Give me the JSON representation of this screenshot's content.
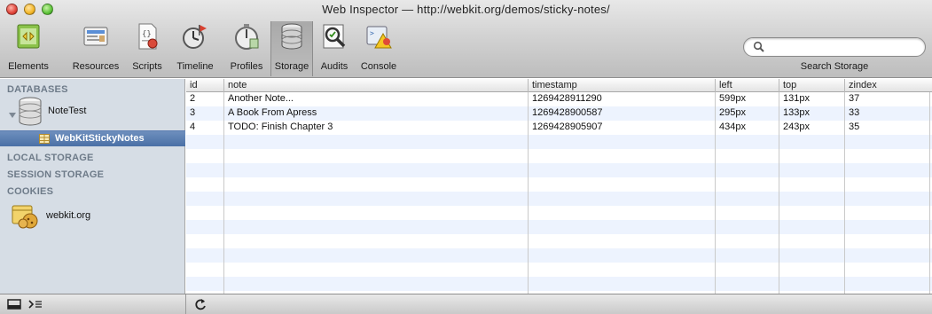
{
  "window": {
    "title": "Web Inspector — http://webkit.org/demos/sticky-notes/"
  },
  "toolbar": {
    "tools": [
      {
        "id": "elements",
        "label": "Elements",
        "icon": "elements-icon"
      },
      {
        "id": "resources",
        "label": "Resources",
        "icon": "resources-icon"
      },
      {
        "id": "scripts",
        "label": "Scripts",
        "icon": "scripts-icon"
      },
      {
        "id": "timeline",
        "label": "Timeline",
        "icon": "timeline-icon"
      },
      {
        "id": "profiles",
        "label": "Profiles",
        "icon": "profiles-icon"
      },
      {
        "id": "storage",
        "label": "Storage",
        "icon": "storage-icon",
        "active": true
      },
      {
        "id": "audits",
        "label": "Audits",
        "icon": "audits-icon"
      },
      {
        "id": "console",
        "label": "Console",
        "icon": "console-icon"
      }
    ],
    "search": {
      "value": "",
      "label": "Search Storage"
    }
  },
  "sidebar": {
    "sections": {
      "databases": "DATABASES",
      "local_storage": "LOCAL STORAGE",
      "session_storage": "SESSION STORAGE",
      "cookies": "COOKIES"
    },
    "database": {
      "name": "NoteTest",
      "expanded": true,
      "tables": [
        {
          "name": "WebKitStickyNotes",
          "selected": true
        }
      ]
    },
    "cookie_domains": [
      {
        "name": "webkit.org"
      }
    ]
  },
  "grid": {
    "columns": [
      "id",
      "note",
      "timestamp",
      "left",
      "top",
      "zindex"
    ],
    "rows": [
      [
        "2",
        "Another Note...",
        "1269428911290",
        "599px",
        "131px",
        "37"
      ],
      [
        "3",
        "A Book From Apress",
        "1269428900587",
        "295px",
        "133px",
        "33"
      ],
      [
        "4",
        "TODO: Finish Chapter 3",
        "1269428905907",
        "434px",
        "243px",
        "35"
      ]
    ]
  },
  "statusbar": {
    "buttons": [
      "dock-icon",
      "console-toggle-icon",
      "refresh-icon"
    ]
  },
  "colors": {
    "selection": "#4a70a6",
    "sidebar_bg": "#d6dde5",
    "section_header": "#6e7b89",
    "stripe": "#edf3fe"
  }
}
